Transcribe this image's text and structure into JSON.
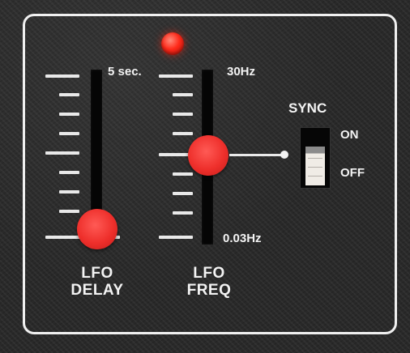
{
  "lfo_delay": {
    "label": "LFO\nDELAY",
    "max_label": "5 sec.",
    "value": 0.04
  },
  "lfo_freq": {
    "label": "LFO\nFREQ",
    "max_label": "30Hz",
    "min_label": "0.03Hz",
    "value": 0.5
  },
  "sync": {
    "title": "SYNC",
    "on_label": "ON",
    "off_label": "OFF",
    "state": "OFF"
  },
  "colors": {
    "panel": "#262626",
    "knob": "#ee2f2b",
    "led": "#ff2a1a",
    "text": "#f3f3f3"
  },
  "icons": {
    "led": "activity-led-icon"
  }
}
